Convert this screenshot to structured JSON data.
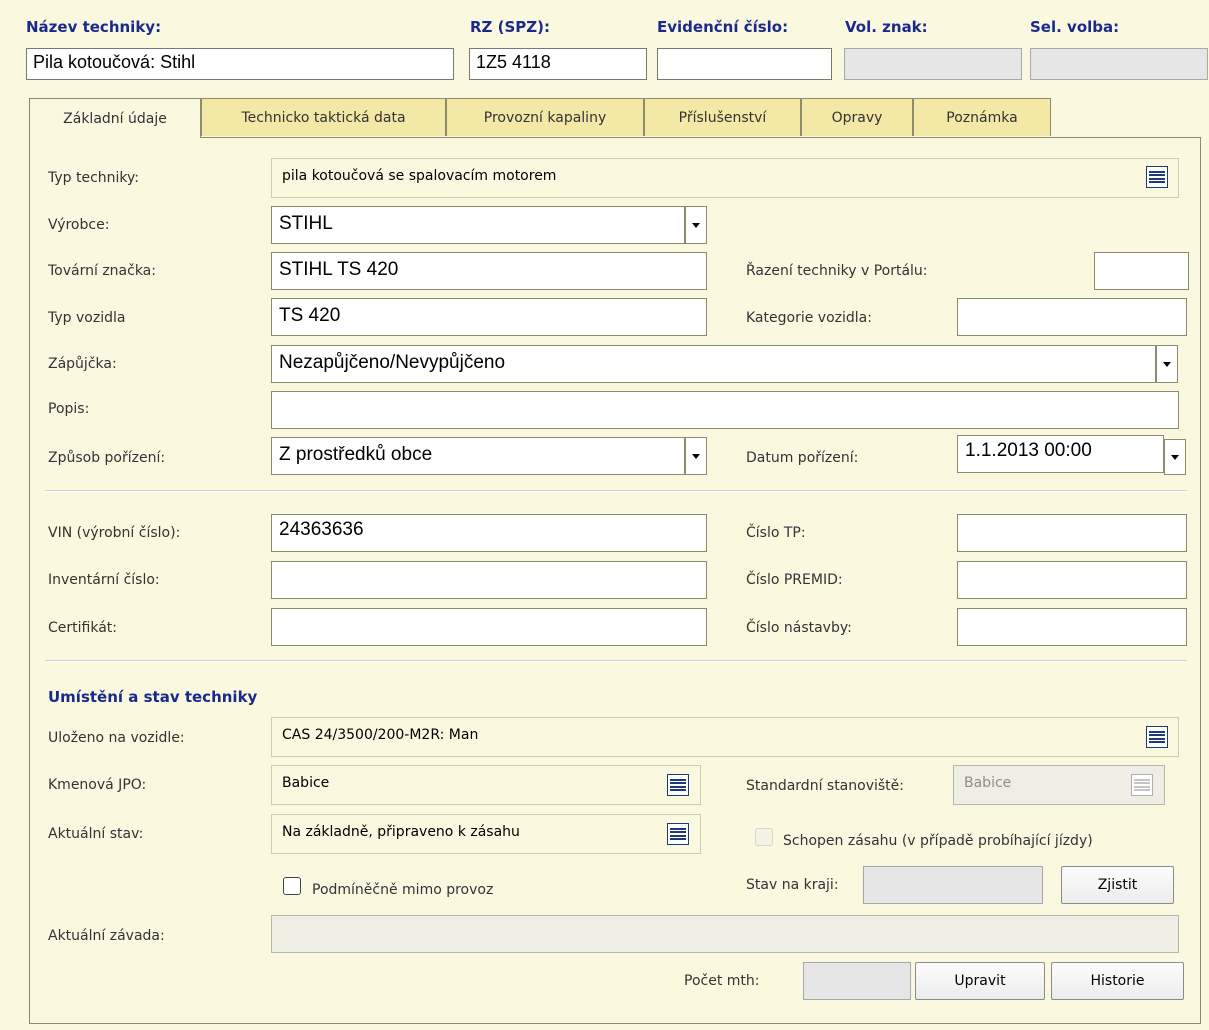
{
  "header": {
    "nazev_label": "Název techniky:",
    "nazev_value": "Pila kotoučová: Stihl",
    "rz_label": "RZ (SPZ):",
    "rz_value": "1Z5 4118",
    "evid_label": "Evidenční číslo:",
    "evid_value": "",
    "vol_label": "Vol. znak:",
    "vol_value": "",
    "sel_label": "Sel. volba:",
    "sel_value": ""
  },
  "tabs": [
    {
      "label": "Základní údaje",
      "active": true
    },
    {
      "label": "Technicko taktická data"
    },
    {
      "label": "Provozní kapaliny"
    },
    {
      "label": "Příslušenství"
    },
    {
      "label": "Opravy"
    },
    {
      "label": "Poznámka"
    }
  ],
  "form": {
    "typ_techniky_label": "Typ techniky:",
    "typ_techniky_value": "pila kotoučová se spalovacím motorem",
    "vyrobce_label": "Výrobce:",
    "vyrobce_value": "STIHL",
    "tovarni_znacka_label": "Tovární značka:",
    "tovarni_znacka_value": "STIHL TS 420",
    "razeni_label": "Řazení techniky v Portálu:",
    "razeni_value": "",
    "typ_vozidla_label": "Typ vozidla",
    "typ_vozidla_value": "TS 420",
    "kategorie_label": "Kategorie vozidla:",
    "kategorie_value": "",
    "zapujcka_label": "Zápůjčka:",
    "zapujcka_value": "Nezapůjčeno/Nevypůjčeno",
    "popis_label": "Popis:",
    "popis_value": "",
    "zpusob_label": "Způsob pořízení:",
    "zpusob_value": "Z prostředků obce",
    "datum_label": "Datum pořízení:",
    "datum_value": "1.1.2013 00:00",
    "vin_label": "VIN (výrobní číslo):",
    "vin_value": "24363636",
    "cislo_tp_label": "Číslo TP:",
    "cislo_tp_value": "",
    "inventarni_label": "Inventární číslo:",
    "inventarni_value": "",
    "premid_label": "Číslo PREMID:",
    "premid_value": "",
    "certifikat_label": "Certifikát:",
    "certifikat_value": "",
    "nastavba_label": "Číslo nástavby:",
    "nastavba_value": ""
  },
  "umisteni": {
    "section_title": "Umístění a stav techniky",
    "ulozeno_label": "Uloženo na vozidle:",
    "ulozeno_value": "CAS 24/3500/200-M2R: Man",
    "kmenova_label": "Kmenová JPO:",
    "kmenova_value": "Babice",
    "standardni_label": "Standardní stanoviště:",
    "standardni_value": "Babice",
    "aktualni_stav_label": "Aktuální stav:",
    "aktualni_stav_value": "Na základně, připraveno k zásahu",
    "schopen_label": "Schopen zásahu (v případě probíhající jízdy)",
    "podminecne_label": "Podmíněčně mimo provoz",
    "stav_kraj_label": "Stav na kraji:",
    "stav_kraj_value": "",
    "zjistit_label": "Zjistit",
    "zavada_label": "Aktuální závada:",
    "zavada_value": "",
    "pocet_mth_label": "Počet mth:",
    "pocet_mth_value": "",
    "upravit_label": "Upravit",
    "historie_label": "Historie"
  },
  "icons": {
    "dropdown": "triangle-down",
    "picker": "list-picker"
  }
}
